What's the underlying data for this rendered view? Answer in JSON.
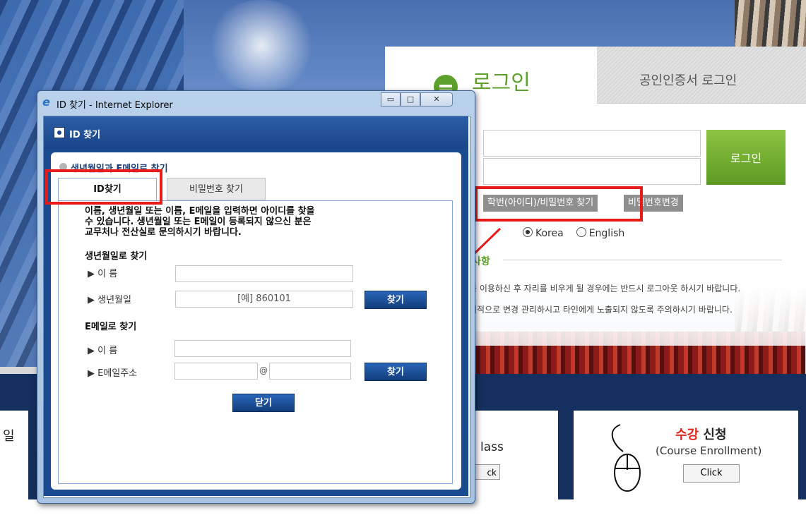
{
  "background_page": {
    "login": {
      "title": "로그인",
      "cert_tab_label": "공인인증서 로그인",
      "login_button": "로그인",
      "find_id_pw_button": "학번(아이디)/비밀번호 찾기",
      "change_pw_button": "비밀번호변경",
      "language_options": [
        "Korea",
        "English"
      ],
      "selected_language": "Korea",
      "notice_heading": "사항",
      "notice_lines": [
        "를 이용하신 후 자리를 비우게 될 경우에는 반드시 로그아웃 하시기 바랍니다.",
        "기적으로 변경 관리하시고 타인에게 노출되지 않도록 주의하시기 바랍니다."
      ]
    },
    "cards": {
      "left_text": "일",
      "mid_text": "lass",
      "mid_button": "ck",
      "right_title_red": "수강",
      "right_title_dark": "신청",
      "right_subtitle": "(Course Enrollment)",
      "right_button": "Click"
    },
    "colors": {
      "accent_green": "#5da02c",
      "annotation_red": "#e81b1b"
    }
  },
  "ie_window": {
    "title": "ID 찾기 - Internet Explorer",
    "controls": {
      "minimize": "▭",
      "maximize": "□",
      "close": "✕"
    }
  },
  "popup": {
    "header_title": "ID 찾기",
    "section_title": "생년월일과 E메일로 찾기",
    "tabs": [
      {
        "label": "ID찾기",
        "active": true
      },
      {
        "label": "비밀번호 찾기",
        "active": false
      }
    ],
    "description": "이름, 생년월일 또는 이름, E메일을 입력하면 아이디를 찾을\n수 있습니다. 생년월일 또는 E메일이 등록되지 않으신 분은\n교무처나 전산실로 문의하시기 바랍니다.",
    "birth_section": {
      "heading": "생년월일로 찾기",
      "name_label": "▶ 이 름",
      "birth_label": "▶ 생년월일",
      "birth_value": "[예] 860101",
      "find_button": "찾기"
    },
    "email_section": {
      "heading": "E메일로 찾기",
      "name_label": "▶ 이 름",
      "email_label": "▶ E메일주소",
      "at_sign": "@",
      "find_button": "찾기"
    },
    "close_button": "닫기"
  }
}
